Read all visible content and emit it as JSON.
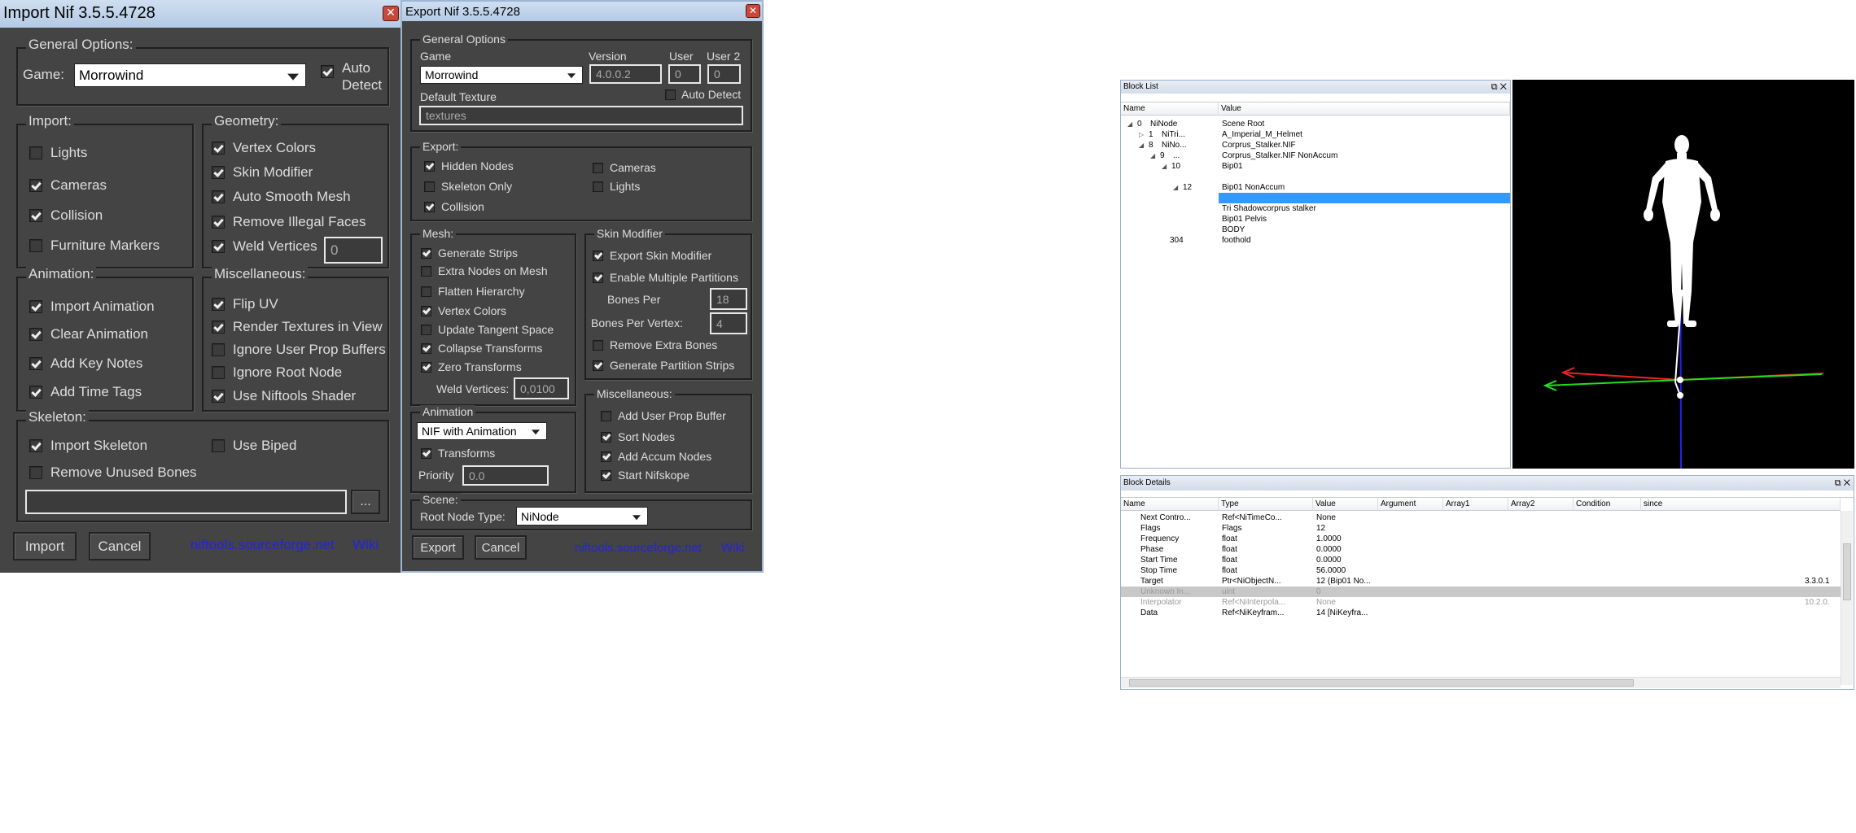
{
  "import_dialog": {
    "title": "Import Nif 3.5.5.4728",
    "general_options": "General Options:",
    "game_label": "Game:",
    "game_value": "Morrowind",
    "auto_detect": "Auto Detect",
    "import_group": "Import:",
    "lights": "Lights",
    "cameras": "Cameras",
    "collision": "Collision",
    "furniture_markers": "Furniture Markers",
    "geometry_group": "Geometry:",
    "vertex_colors": "Vertex Colors",
    "skin_modifier": "Skin Modifier",
    "auto_smooth_mesh": "Auto Smooth Mesh",
    "remove_illegal_faces": "Remove Illegal Faces",
    "weld_vertices": "Weld Vertices",
    "weld_value": "0",
    "animation_group": "Animation:",
    "import_animation": "Import Animation",
    "clear_animation": "Clear Animation",
    "add_key_notes": "Add Key Notes",
    "add_time_tags": "Add Time Tags",
    "misc_group": "Miscellaneous:",
    "flip_uv": "Flip UV",
    "render_textures": "Render Textures in View",
    "ignore_user_prop": "Ignore User Prop Buffers",
    "ignore_root_node": "Ignore Root Node",
    "use_niftools_shader": "Use Niftools Shader",
    "skeleton_group": "Skeleton:",
    "import_skeleton": "Import Skeleton",
    "use_biped": "Use Biped",
    "remove_unused_bones": "Remove Unused Bones",
    "skeleton_path": "",
    "browse": "...",
    "import_btn": "Import",
    "cancel_btn": "Cancel",
    "link": "niftools.sourceforge.net",
    "wiki": "Wiki"
  },
  "export_dialog": {
    "title": "Export Nif 3.5.5.4728",
    "general_options": "General Options",
    "game_label": "Game",
    "game_value": "Morrowind",
    "version_label": "Version",
    "version_value": "4.0.0.2",
    "user_label": "User",
    "user_value": "0",
    "user2_label": "User 2",
    "user2_value": "0",
    "default_texture_label": "Default Texture",
    "auto_detect": "Auto Detect",
    "texture_value": "textures",
    "export_group": "Export:",
    "hidden_nodes": "Hidden Nodes",
    "skeleton_only": "Skeleton Only",
    "collision": "Collision",
    "cameras": "Cameras",
    "lights": "Lights",
    "mesh_group": "Mesh:",
    "generate_strips": "Generate Strips",
    "extra_nodes_on_mesh": "Extra Nodes on Mesh",
    "flatten_hierarchy": "Flatten Hierarchy",
    "vertex_colors": "Vertex Colors",
    "update_tangent_space": "Update Tangent Space",
    "collapse_transforms": "Collapse Transforms",
    "zero_transforms": "Zero Transforms",
    "weld_vertices_label": "Weld Vertices:",
    "weld_value": "0,0100",
    "skin_group": "Skin Modifier",
    "export_skin_modifier": "Export Skin Modifier",
    "enable_multiple_partitions": "Enable Multiple Partitions",
    "bones_per_label": "Bones Per",
    "bones_per_value": "18",
    "bones_per_vertex_label": "Bones Per Vertex:",
    "bones_per_vertex_value": "4",
    "remove_extra_bones": "Remove Extra Bones",
    "generate_partition_strips": "Generate Partition Strips",
    "animation_group": "Animation",
    "animation_mode": "NIF with Animation",
    "transforms": "Transforms",
    "priority_label": "Priority",
    "priority_value": "0.0",
    "misc_group": "Miscellaneous:",
    "add_user_prop_buffer": "Add User Prop Buffer",
    "sort_nodes": "Sort Nodes",
    "add_accum_nodes": "Add Accum Nodes",
    "start_nifskope": "Start Nifskope",
    "scene_group": "Scene:",
    "root_node_type_label": "Root Node Type:",
    "root_node_type_value": "NiNode",
    "export_btn": "Export",
    "cancel_btn": "Cancel",
    "link": "niftools.sourceforge.net",
    "wiki": "Wiki"
  },
  "block_list": {
    "title": "Block List",
    "col_name": "Name",
    "col_value": "Value",
    "rows": [
      {
        "arrow": "◢",
        "index": "0",
        "name": "NiNode",
        "value": "Scene Root"
      },
      {
        "arrow": "▷",
        "index": "1",
        "name": "NiTri...",
        "value": "A_Imperial_M_Helmet"
      },
      {
        "arrow": "◢",
        "index": "8",
        "name": "NiNo...",
        "value": "Corprus_Stalker.NIF"
      },
      {
        "arrow": "◢",
        "index": "9",
        "name": "...",
        "value": "Corprus_Stalker.NIF NonAccum"
      },
      {
        "arrow": "◢",
        "index": "10",
        "name": "",
        "value": "Bip01"
      },
      {
        "arrow": "",
        "index": "",
        "name": "",
        "value": ""
      },
      {
        "arrow": "◢",
        "index": "12",
        "name": "",
        "value": "Bip01 NonAccum"
      },
      {
        "arrow": "",
        "index": "",
        "name": "",
        "value": ""
      },
      {
        "arrow": "",
        "index": "",
        "name": "",
        "value": "Tri Shadowcorprus stalker"
      },
      {
        "arrow": "",
        "index": "",
        "name": "",
        "value": "Bip01 Pelvis"
      },
      {
        "arrow": "",
        "index": "",
        "name": "",
        "value": "BODY"
      },
      {
        "arrow": "",
        "index": "304",
        "name": "",
        "value": "foothold"
      }
    ]
  },
  "block_details": {
    "title": "Block Details",
    "columns": [
      "Name",
      "Type",
      "Value",
      "Argument",
      "Array1",
      "Array2",
      "Condition",
      "since"
    ],
    "rows": [
      {
        "name": "Next Contro...",
        "type": "Ref<NiTimeCo...",
        "value": "None",
        "since": "",
        "grey": false
      },
      {
        "name": "Flags",
        "type": "Flags",
        "value": "12",
        "since": "",
        "grey": false
      },
      {
        "name": "Frequency",
        "type": "float",
        "value": "1.0000",
        "since": "",
        "grey": false
      },
      {
        "name": "Phase",
        "type": "float",
        "value": "0.0000",
        "since": "",
        "grey": false
      },
      {
        "name": "Start Time",
        "type": "float",
        "value": "0.0000",
        "since": "",
        "grey": false
      },
      {
        "name": "Stop Time",
        "type": "float",
        "value": "56.0000",
        "since": "",
        "grey": false
      },
      {
        "name": "Target",
        "type": "Ptr<NiObjectN...",
        "value": "12 (Bip01 No...",
        "since": "3.3.0.1",
        "grey": false
      },
      {
        "name": "Unknown In...",
        "type": "uint",
        "value": "0",
        "since": "",
        "grey": true
      },
      {
        "name": "Interpolator",
        "type": "Ref<NiInterpola...",
        "value": "None",
        "since": "10.2.0.",
        "grey": true
      },
      {
        "name": "Data",
        "type": "Ref<NiKeyfram...",
        "value": "14 [NiKeyfra...",
        "since": "",
        "grey": false
      }
    ]
  }
}
